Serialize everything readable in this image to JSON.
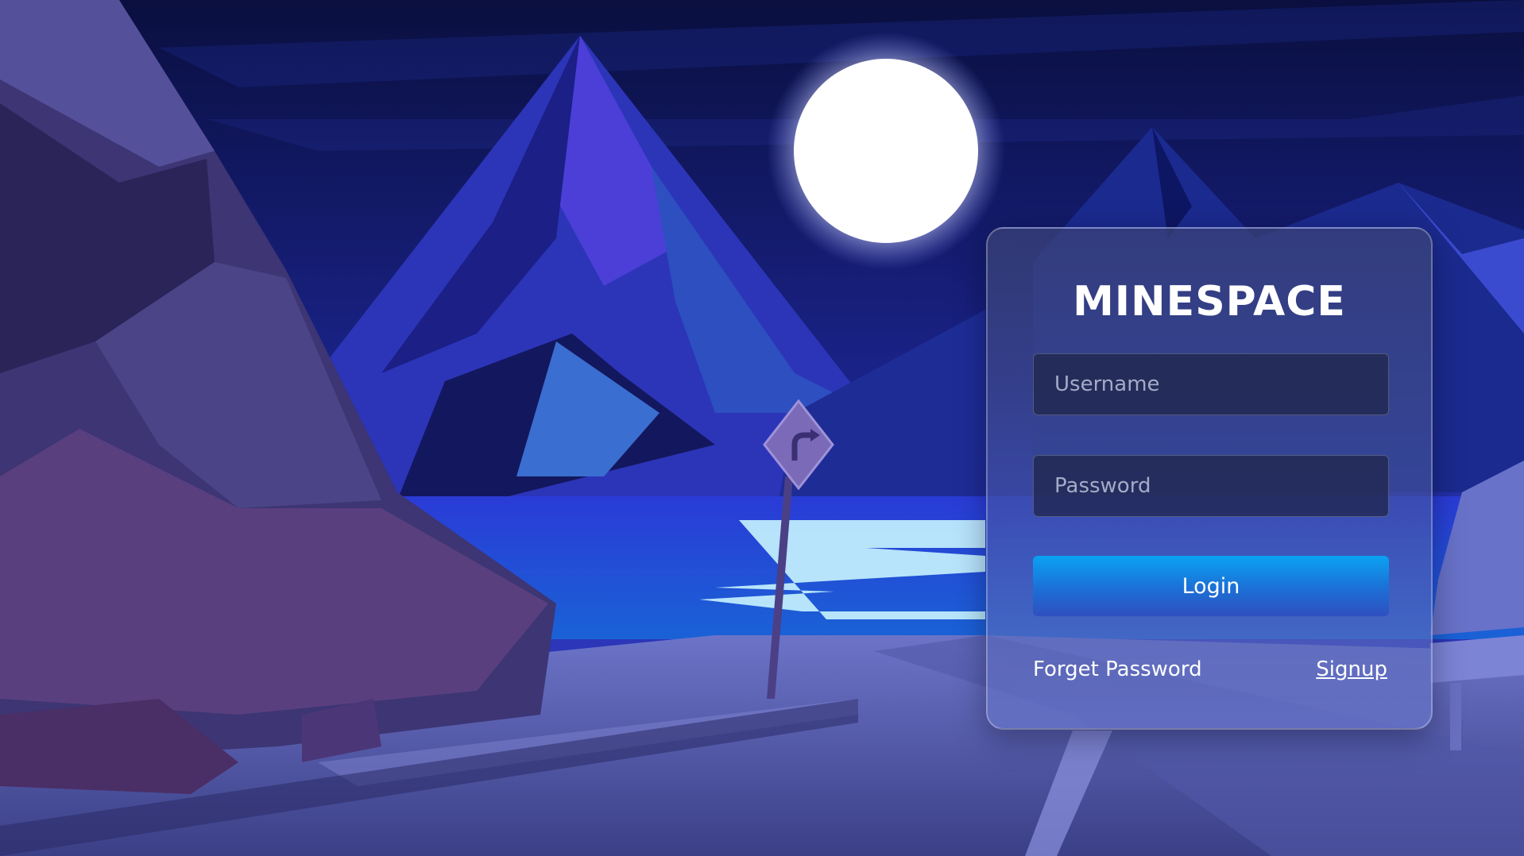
{
  "app": {
    "title": "MINESPACE"
  },
  "login_form": {
    "username": {
      "placeholder": "Username",
      "value": ""
    },
    "password": {
      "placeholder": "Password",
      "value": ""
    },
    "login_label": "Login",
    "forgot_label": "Forget Password",
    "signup_label": "Signup"
  },
  "colors": {
    "sky": "#0b1044",
    "moon": "#ffffff",
    "login_button": "#1c6fd6",
    "card": "#3c4476"
  },
  "scene": {
    "description_icons": [
      "moon-icon",
      "mountain-icon",
      "road-sign-icon"
    ]
  }
}
